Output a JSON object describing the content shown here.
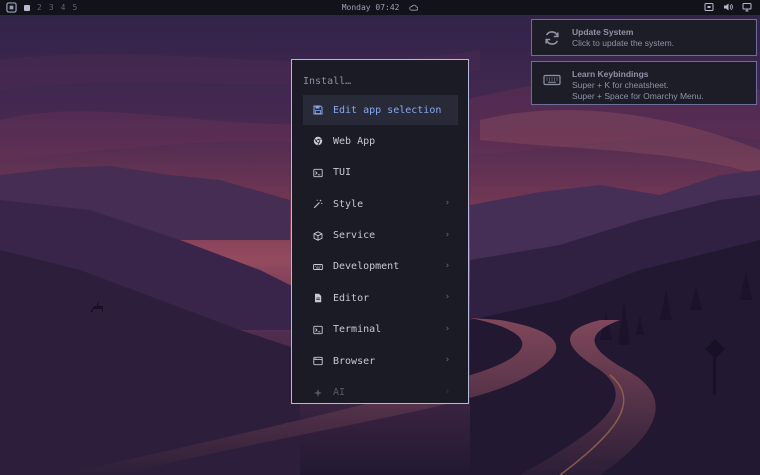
{
  "topbar": {
    "logo_icon": "omarchy-logo-icon",
    "workspaces": [
      "2",
      "3",
      "4",
      "5"
    ],
    "clock": "Monday 07:42",
    "weather_icon": "cloud-icon",
    "tray_icons": [
      "screen-record-icon",
      "volume-icon",
      "display-icon"
    ]
  },
  "notifications": [
    {
      "icon": "refresh-icon",
      "title": "Update System",
      "body": [
        "Click to update the system."
      ]
    },
    {
      "icon": "keyboard-icon",
      "title": "Learn Keybindings",
      "body": [
        "Super + K for cheatsheet.",
        "Super + Space for Omarchy Menu."
      ]
    }
  ],
  "menu": {
    "title": "Install…",
    "items": [
      {
        "label": "Edit app selection",
        "icon": "save-icon",
        "submenu": false,
        "selected": true
      },
      {
        "label": "Web App",
        "icon": "chrome-icon",
        "submenu": false
      },
      {
        "label": "TUI",
        "icon": "terminal-icon",
        "submenu": false
      },
      {
        "label": "Style",
        "icon": "magic-wand-icon",
        "submenu": true
      },
      {
        "label": "Service",
        "icon": "cube-icon",
        "submenu": true
      },
      {
        "label": "Development",
        "icon": "keyboard-small-icon",
        "submenu": true
      },
      {
        "label": "Editor",
        "icon": "file-icon",
        "submenu": true
      },
      {
        "label": "Terminal",
        "icon": "terminal-icon",
        "submenu": true
      },
      {
        "label": "Browser",
        "icon": "browser-window-icon",
        "submenu": true
      },
      {
        "label": "AI",
        "icon": "ai-icon",
        "submenu": true
      }
    ],
    "chevron": "›"
  },
  "colors": {
    "accent": "#8aa8ef",
    "menu_bg": "#1a1b24",
    "menu_border": "#b7b9d8",
    "notif_border": "#6b6f99"
  }
}
